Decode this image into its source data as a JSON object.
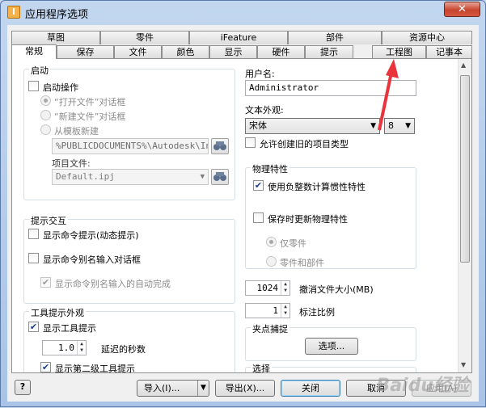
{
  "window": {
    "title": "应用程序选项",
    "close": "✕"
  },
  "tabs_back": [
    "草图",
    "零件",
    "iFeature",
    "部件",
    "资源中心"
  ],
  "tabs_front": [
    "常规",
    "保存",
    "文件",
    "颜色",
    "显示",
    "硬件",
    "提示",
    "工程图",
    "记事本"
  ],
  "startup": {
    "title": "启动",
    "action_label": "启动操作",
    "open_file": "“打开文件”对话框",
    "new_file": "“新建文件”对话框",
    "from_template": "从模板新建",
    "template_path": "%PUBLICDOCUMENTS%\\Autodesk\\Inventor",
    "project_label": "项目文件:",
    "project_value": "Default.ipj"
  },
  "prompt": {
    "title": "提示交互",
    "show_prompt": "显示命令提示(动态提示)",
    "show_alias": "显示命令别名输入对话框",
    "auto_complete": "显示命令别名输入的自动完成"
  },
  "tooltip": {
    "title": "工具提示外观",
    "show_tips": "显示工具提示",
    "delay_value": "1.0",
    "delay_label": "延迟的秒数",
    "show_second": "显示第二级工具提示"
  },
  "user": {
    "label": "用户名:",
    "value": "Administrator"
  },
  "text_appearance": {
    "label": "文本外观:",
    "font": "宋体",
    "size": "8",
    "allow_legacy": "允许创建旧的项目类型"
  },
  "physical": {
    "title": "物理特性",
    "use_negative": "使用负整数计算惯性特性",
    "update_on_save": "保存时更新物理特性",
    "parts_only": "仅零件",
    "parts_and_assemblies": "零件和部件"
  },
  "undo": {
    "value": "1024",
    "label": "撤消文件大小(MB)"
  },
  "annotation": {
    "value": "1",
    "label": "标注比例"
  },
  "snap": {
    "title": "夹点捕捉",
    "options_button": "选项..."
  },
  "selection_title": "选择",
  "buttons": {
    "help": "?",
    "import": "导入(I)...",
    "export": "导出(X)...",
    "close": "关闭",
    "cancel": "取消",
    "apply": "应用(A)"
  },
  "watermark": "Baidu经验",
  "colors": {
    "accent_red": "#e8343a",
    "window_blue": "#a9c4e6"
  }
}
